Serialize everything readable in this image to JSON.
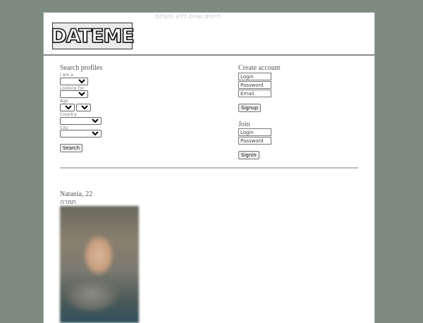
{
  "header": {
    "tagline": "דייטים שווים ללא תשלום",
    "logo_text": "DATEME"
  },
  "search": {
    "title": "Search profiles",
    "i_am_label": "I am a",
    "looking_for_label": "Looking For",
    "age_label": "Age",
    "country_label": "Country",
    "city_label": "City",
    "button": "Search"
  },
  "create_account": {
    "title": "Create account",
    "login_placeholder": "Login",
    "password_placeholder": "Password",
    "email_placeholder": "Email",
    "button": "Signup"
  },
  "join": {
    "title": "Join",
    "login_placeholder": "Login",
    "password_placeholder": "Password",
    "button": "Signin"
  },
  "profile": {
    "name_age": "Natania, 22",
    "subtitle": "תמרה"
  },
  "colors": {
    "page_background": "#7d8a80",
    "content_background": "#ffffff"
  }
}
